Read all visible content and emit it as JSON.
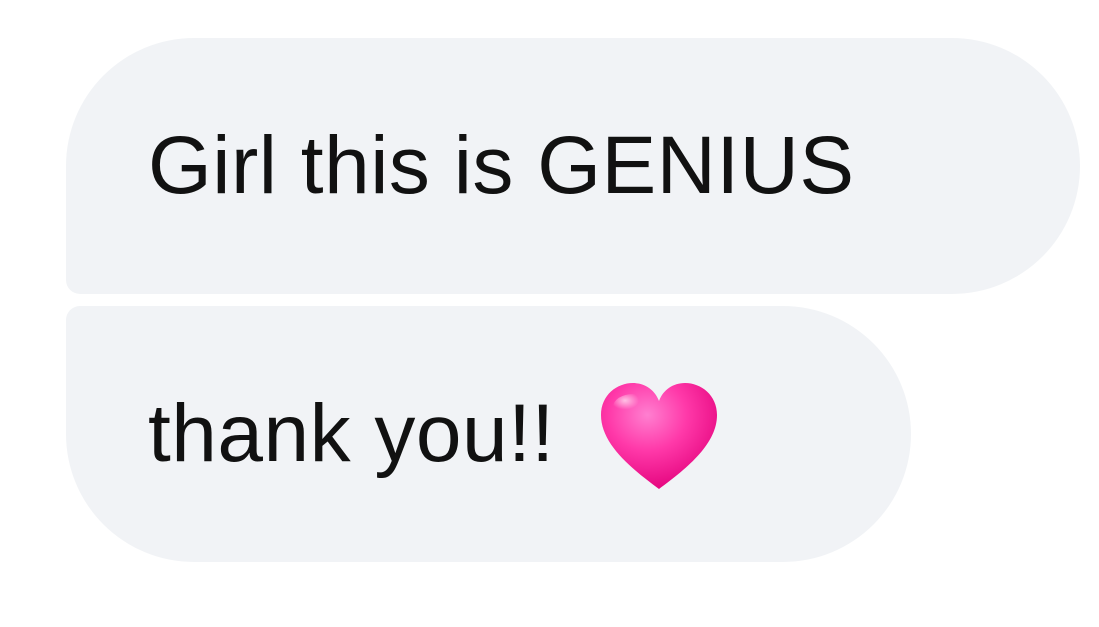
{
  "messages": [
    {
      "text": "Girl this is GENIUS"
    },
    {
      "text": "thank you!!",
      "emoji": "pink-heart-icon"
    }
  ],
  "colors": {
    "bubble_background": "#f1f3f6",
    "text": "#111111",
    "heart": "#ff2fa2"
  }
}
